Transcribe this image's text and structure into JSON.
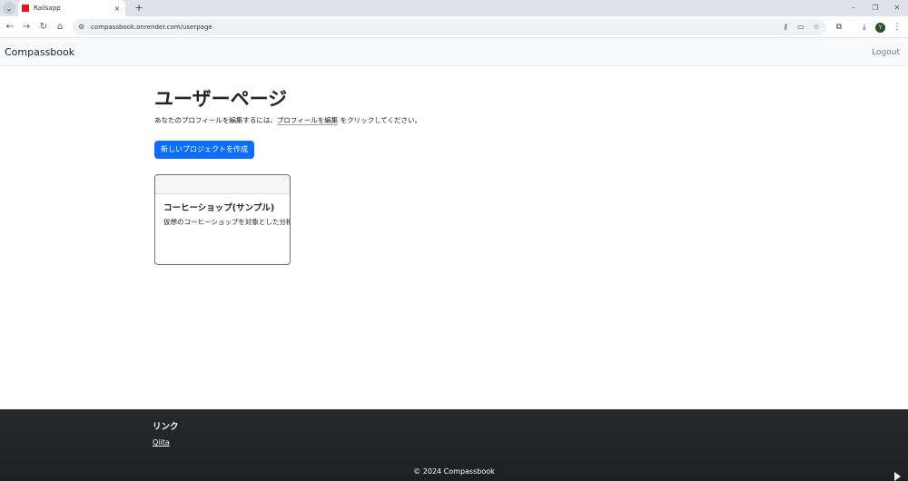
{
  "browser": {
    "tab_search_glyph": "⌄",
    "tab_title": "Railsapp",
    "tab_close": "×",
    "new_tab": "+",
    "minimize": "–",
    "restore": "❐",
    "close": "✕",
    "back": "←",
    "forward": "→",
    "reload": "↻",
    "home": "⌂",
    "site_info": "⚙",
    "url": "compassbook.onrender.com/userpage",
    "key_icon": "⚷",
    "cast_icon": "▭",
    "star_icon": "☆",
    "extensions_icon": "⧉",
    "download_icon": "⤓",
    "profile_initial": "Y",
    "menu_icon": "⋮",
    "colors": {
      "favicon": "#e0151d",
      "avatar": "#2f4d2b"
    }
  },
  "navbar": {
    "brand": "Compassbook",
    "logout": "Logout"
  },
  "main": {
    "title": "ユーザーページ",
    "desc_before": "あなたのプロフィールを編集するには、",
    "desc_link": "プロフィールを編集",
    "desc_after": " をクリックしてください。",
    "new_project_button": "新しいプロジェクトを作成",
    "colors": {
      "primary": "#0d6efd"
    },
    "projects": [
      {
        "title": "コーヒーショップ(サンプル)",
        "description": "仮想のコーヒーショップを対象とした分析"
      }
    ]
  },
  "footer": {
    "heading": "リンク",
    "link": "Qiita",
    "copyright": "© 2024 Compassbook"
  }
}
